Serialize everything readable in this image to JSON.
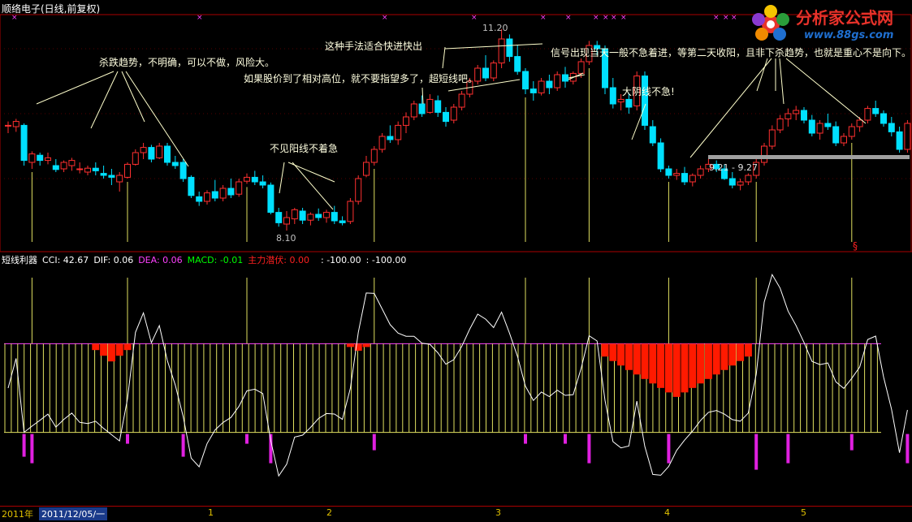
{
  "window": {
    "title": "顺络电子(日线,前复权)"
  },
  "logo": {
    "name": "分析家公式网",
    "url": "www.88gs.com"
  },
  "indicator": {
    "name": "短线利器",
    "fields": [
      {
        "label": "CCI: 42.67",
        "color": "#ffffff"
      },
      {
        "label": "DIF: 0.06",
        "color": "#ffffff"
      },
      {
        "label": "DEA: 0.06",
        "color": "#ff40ff"
      },
      {
        "label": "MACD: -0.01",
        "color": "#00ff00"
      },
      {
        "label": "主力潜伏: 0.00",
        "color": "#ff2020"
      },
      {
        "label": ": -100.00",
        "color": "#ffffff"
      },
      {
        "label": ": -100.00",
        "color": "#ffffff"
      }
    ]
  },
  "annotations": [
    "杀跌趋势，不明确，可以不做，风险大。",
    "不见阳线不着急",
    "这种手法适合快进快出",
    "如果股价到了相对高位，就不要指望多了，超短线吧。",
    "信号出现当天一般不急着进，等第二天收阳，且非下杀趋势，也就是重心不是向下。",
    "大阴线不急!"
  ],
  "price_labels": {
    "high": "11.20",
    "low": "8.10",
    "range": "9.21 - 9.27"
  },
  "marker": "§",
  "xaxis": {
    "year": "2011年",
    "date": "2011/12/05/一",
    "months": [
      "1",
      "2",
      "3",
      "4",
      "5"
    ]
  },
  "colors": {
    "up": "#ff3030",
    "down": "#00e0ff",
    "signal": "#e0e060",
    "cci": "#ffffff",
    "zone": "#e0e060",
    "lower_bar": "#e020e0",
    "fill": "#ff1a00"
  },
  "chart_data": {
    "type": "candlestick",
    "candles": [
      [
        9.72,
        9.78,
        9.6,
        9.72
      ],
      [
        9.7,
        9.82,
        9.62,
        9.78
      ],
      [
        9.72,
        9.75,
        9.1,
        9.18
      ],
      [
        9.15,
        9.32,
        9.05,
        9.28
      ],
      [
        9.26,
        9.3,
        9.1,
        9.18
      ],
      [
        9.18,
        9.3,
        9.12,
        9.22
      ],
      [
        9.1,
        9.2,
        9.0,
        9.04
      ],
      [
        9.05,
        9.18,
        9.0,
        9.15
      ],
      [
        9.1,
        9.22,
        9.02,
        9.18
      ],
      [
        9.05,
        9.15,
        8.98,
        9.05
      ],
      [
        9.0,
        9.1,
        8.95,
        9.06
      ],
      [
        9.06,
        9.15,
        8.95,
        9.02
      ],
      [
        8.98,
        9.1,
        8.9,
        8.95
      ],
      [
        8.95,
        9.05,
        8.8,
        8.92
      ],
      [
        8.85,
        9.0,
        8.7,
        8.95
      ],
      [
        8.92,
        9.15,
        8.9,
        9.12
      ],
      [
        9.12,
        9.35,
        9.1,
        9.3
      ],
      [
        9.3,
        9.45,
        9.2,
        9.38
      ],
      [
        9.38,
        9.42,
        9.15,
        9.2
      ],
      [
        9.22,
        9.45,
        9.2,
        9.4
      ],
      [
        9.4,
        9.45,
        9.1,
        9.15
      ],
      [
        9.15,
        9.25,
        9.05,
        9.1
      ],
      [
        9.15,
        9.2,
        8.85,
        8.9
      ],
      [
        8.92,
        8.95,
        8.6,
        8.64
      ],
      [
        8.62,
        8.7,
        8.48,
        8.55
      ],
      [
        8.55,
        8.72,
        8.5,
        8.68
      ],
      [
        8.7,
        8.88,
        8.55,
        8.6
      ],
      [
        8.6,
        8.8,
        8.55,
        8.75
      ],
      [
        8.75,
        8.9,
        8.6,
        8.65
      ],
      [
        8.66,
        8.9,
        8.62,
        8.85
      ],
      [
        8.86,
        8.98,
        8.82,
        8.92
      ],
      [
        8.92,
        9.02,
        8.8,
        8.85
      ],
      [
        8.85,
        8.95,
        8.75,
        8.8
      ],
      [
        8.8,
        8.84,
        8.35,
        8.38
      ],
      [
        8.38,
        8.45,
        8.16,
        8.22
      ],
      [
        8.2,
        8.4,
        8.1,
        8.3
      ],
      [
        8.28,
        8.45,
        8.2,
        8.42
      ],
      [
        8.4,
        8.45,
        8.2,
        8.26
      ],
      [
        8.26,
        8.38,
        8.18,
        8.35
      ],
      [
        8.35,
        8.44,
        8.25,
        8.3
      ],
      [
        8.3,
        8.42,
        8.22,
        8.38
      ],
      [
        8.38,
        8.48,
        8.2,
        8.25
      ],
      [
        8.25,
        8.32,
        8.18,
        8.22
      ],
      [
        8.24,
        8.6,
        8.2,
        8.55
      ],
      [
        8.55,
        8.95,
        8.5,
        8.9
      ],
      [
        8.95,
        9.25,
        8.92,
        9.15
      ],
      [
        9.15,
        9.4,
        9.1,
        9.35
      ],
      [
        9.35,
        9.6,
        9.3,
        9.55
      ],
      [
        9.55,
        9.72,
        9.45,
        9.5
      ],
      [
        9.5,
        9.78,
        9.42,
        9.72
      ],
      [
        9.72,
        9.92,
        9.6,
        9.85
      ],
      [
        9.85,
        10.1,
        9.8,
        10.05
      ],
      [
        10.05,
        10.18,
        9.85,
        9.9
      ],
      [
        9.92,
        10.2,
        9.9,
        10.12
      ],
      [
        10.1,
        10.18,
        9.85,
        9.92
      ],
      [
        9.92,
        10.0,
        9.7,
        9.78
      ],
      [
        9.8,
        10.05,
        9.75,
        10.0
      ],
      [
        10.0,
        10.25,
        9.95,
        10.2
      ],
      [
        10.2,
        10.45,
        10.15,
        10.4
      ],
      [
        10.4,
        10.65,
        10.35,
        10.6
      ],
      [
        10.6,
        10.8,
        10.4,
        10.45
      ],
      [
        10.45,
        10.72,
        10.4,
        10.68
      ],
      [
        10.68,
        11.2,
        10.6,
        11.05
      ],
      [
        11.05,
        11.12,
        10.7,
        10.78
      ],
      [
        10.78,
        10.95,
        10.5,
        10.55
      ],
      [
        10.55,
        10.6,
        10.2,
        10.28
      ],
      [
        10.28,
        10.4,
        10.1,
        10.22
      ],
      [
        10.22,
        10.45,
        10.18,
        10.4
      ],
      [
        10.4,
        10.5,
        10.2,
        10.3
      ],
      [
        10.3,
        10.55,
        10.25,
        10.5
      ],
      [
        10.5,
        10.62,
        10.3,
        10.4
      ],
      [
        10.4,
        10.55,
        10.35,
        10.52
      ],
      [
        10.52,
        10.75,
        10.45,
        10.7
      ],
      [
        10.7,
        11.02,
        10.65,
        10.95
      ],
      [
        10.95,
        11.02,
        10.8,
        10.9
      ],
      [
        10.9,
        10.95,
        10.2,
        10.3
      ],
      [
        10.3,
        10.45,
        9.98,
        10.05
      ],
      [
        10.08,
        10.2,
        9.95,
        10.12
      ],
      [
        10.12,
        10.22,
        9.9,
        10.0
      ],
      [
        10.02,
        10.55,
        9.95,
        10.48
      ],
      [
        10.48,
        10.55,
        9.65,
        9.72
      ],
      [
        9.7,
        9.8,
        9.4,
        9.45
      ],
      [
        9.45,
        9.52,
        9.0,
        9.05
      ],
      [
        9.05,
        9.1,
        8.9,
        8.95
      ],
      [
        8.95,
        9.05,
        8.88,
        8.98
      ],
      [
        8.98,
        9.08,
        8.8,
        8.85
      ],
      [
        8.85,
        8.98,
        8.78,
        8.95
      ],
      [
        8.95,
        9.1,
        8.9,
        9.05
      ],
      [
        9.05,
        9.2,
        9.0,
        9.12
      ],
      [
        9.12,
        9.18,
        9.0,
        9.05
      ],
      [
        9.05,
        9.12,
        8.88,
        8.9
      ],
      [
        8.9,
        9.0,
        8.75,
        8.8
      ],
      [
        8.8,
        8.9,
        8.72,
        8.85
      ],
      [
        8.85,
        8.98,
        8.8,
        8.95
      ],
      [
        8.95,
        9.2,
        8.9,
        9.15
      ],
      [
        9.15,
        9.45,
        9.1,
        9.4
      ],
      [
        9.4,
        9.72,
        9.35,
        9.65
      ],
      [
        9.65,
        9.88,
        9.6,
        9.82
      ],
      [
        9.82,
        9.98,
        9.7,
        9.9
      ],
      [
        9.9,
        10.02,
        9.8,
        9.95
      ],
      [
        9.95,
        10.0,
        9.75,
        9.8
      ],
      [
        9.8,
        9.88,
        9.55,
        9.6
      ],
      [
        9.6,
        9.8,
        9.5,
        9.75
      ],
      [
        9.75,
        9.9,
        9.65,
        9.7
      ],
      [
        9.7,
        9.78,
        9.4,
        9.45
      ],
      [
        9.45,
        9.6,
        9.4,
        9.55
      ],
      [
        9.55,
        9.75,
        9.5,
        9.7
      ],
      [
        9.7,
        9.85,
        9.62,
        9.8
      ],
      [
        9.8,
        10.02,
        9.75,
        9.98
      ],
      [
        9.98,
        10.1,
        9.85,
        9.9
      ],
      [
        9.9,
        9.95,
        9.7,
        9.75
      ],
      [
        9.75,
        9.85,
        9.55,
        9.62
      ],
      [
        9.62,
        9.7,
        9.3,
        9.35
      ],
      [
        9.35,
        9.8,
        9.3,
        9.75
      ]
    ],
    "signal_days": [
      3,
      15,
      30,
      46,
      65,
      73,
      83,
      94,
      106,
      117
    ],
    "cci_zone": [
      -100,
      100
    ],
    "main_lurk_max": 0.6
  }
}
